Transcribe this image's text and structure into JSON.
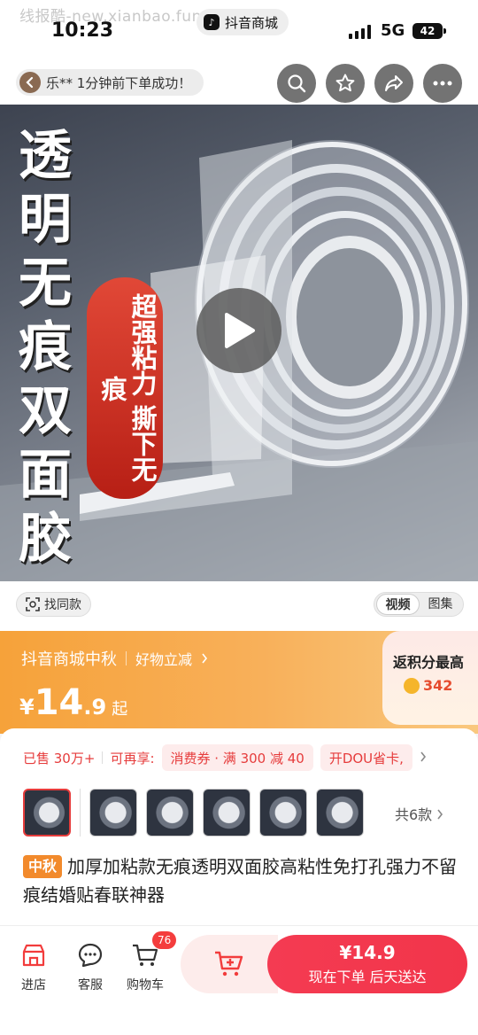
{
  "status": {
    "watermark": "线报酷-new.xianbao.fun",
    "time": "10:23",
    "app_name": "抖音商城",
    "network": "5G",
    "battery": "42"
  },
  "topbar": {
    "toast": "乐** 1分钟前下单成功！",
    "icons": [
      "back-icon",
      "search-icon",
      "star-icon",
      "share-icon",
      "more-icon"
    ]
  },
  "hero": {
    "title_chars": [
      "透",
      "明",
      "无",
      "痕",
      "双",
      "面",
      "胶"
    ],
    "badge": "超强粘力 撕下无痕"
  },
  "media": {
    "find_same": "找同款",
    "tabs": [
      {
        "label": "视频",
        "active": true
      },
      {
        "label": "图集",
        "active": false
      }
    ]
  },
  "promo": {
    "event": "抖音商城中秋",
    "sub": "好物立减",
    "price_cur": "¥",
    "price_int": "14",
    "price_dec": ".9",
    "price_suffix": "起",
    "cashback_title": "返积分最高",
    "cashback_value": "342"
  },
  "info": {
    "sold": "已售 30万+",
    "can_enjoy": "可再享:",
    "coupon": "消费券 · 满 300 减 40",
    "dou": "开DOU省卡,",
    "variant_count": "共6款",
    "title_tag": "中秋",
    "title": "加厚加粘款无痕透明双面胶高粘性免打孔强力不留痕结婚贴春联神器"
  },
  "bottom": {
    "nav": [
      {
        "label": "进店"
      },
      {
        "label": "客服"
      },
      {
        "label": "购物车"
      }
    ],
    "cart_badge": "76",
    "buy_price": "¥14.9",
    "buy_label": "现在下单  后天送达"
  },
  "colors": {
    "accent": "#f43b52",
    "promo": "#f6a23a",
    "sold": "#e63c3c"
  }
}
